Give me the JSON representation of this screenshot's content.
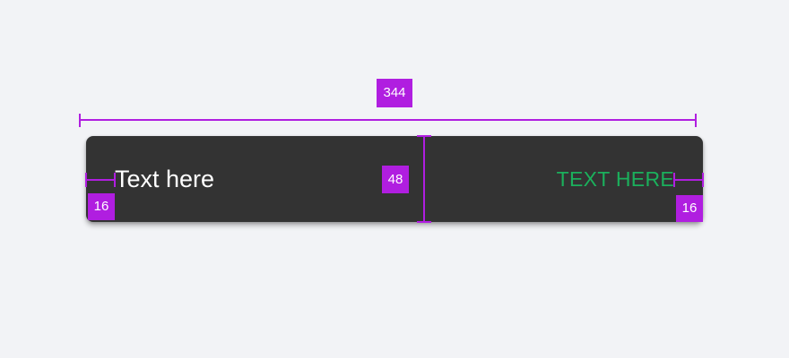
{
  "snackbar": {
    "text": "Text here",
    "action_label": "TEXT HERE",
    "background_color": "#333333",
    "text_color": "#ffffff",
    "action_color": "#1bb05c"
  },
  "annotations": {
    "width_label": "344",
    "height_label": "48",
    "left_padding_label": "16",
    "right_padding_label": "16",
    "color": "#b01ee0"
  }
}
